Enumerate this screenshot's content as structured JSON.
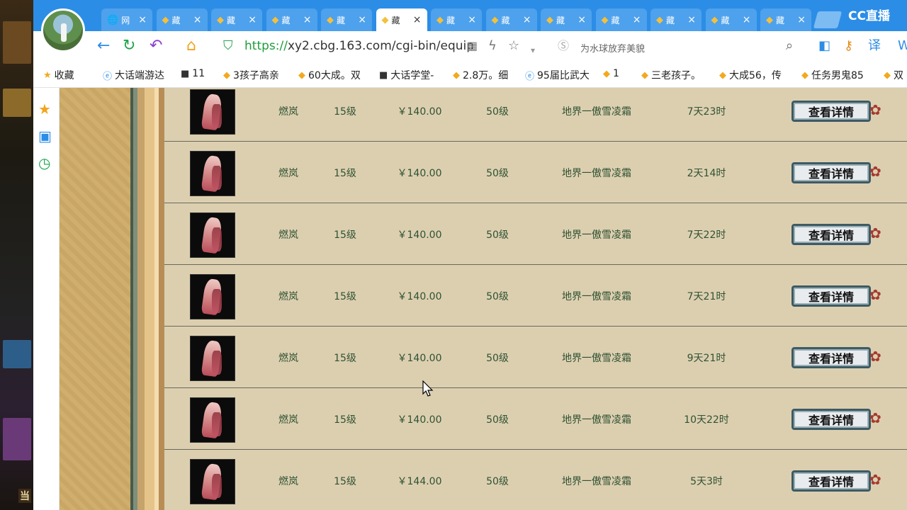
{
  "game_overlay": {
    "text": "当"
  },
  "browser": {
    "tabs": [
      {
        "title": "网",
        "icon": "globe-icon",
        "active": false
      },
      {
        "title": "藏",
        "icon": "cbg-icon",
        "active": false
      },
      {
        "title": "藏",
        "icon": "cbg-icon",
        "active": false
      },
      {
        "title": "藏",
        "icon": "cbg-icon",
        "active": false
      },
      {
        "title": "藏",
        "icon": "cbg-icon",
        "active": false
      },
      {
        "title": "藏",
        "icon": "cbg-icon",
        "active": true
      },
      {
        "title": "藏",
        "icon": "cbg-icon",
        "active": false
      },
      {
        "title": "藏",
        "icon": "cbg-icon",
        "active": false
      },
      {
        "title": "藏",
        "icon": "cbg-icon",
        "active": false
      },
      {
        "title": "藏",
        "icon": "cbg-icon",
        "active": false
      },
      {
        "title": "藏",
        "icon": "cbg-icon",
        "active": false
      },
      {
        "title": "藏",
        "icon": "cbg-icon",
        "active": false
      },
      {
        "title": "藏",
        "icon": "cbg-icon",
        "active": false
      }
    ],
    "brand": "CC直播",
    "url_scheme": "https://",
    "url_rest": "xy2.cbg.163.com/cgi-bin/equip",
    "search_suggestion": "为水球放弃美貌"
  },
  "bookmarks": [
    {
      "label": "收藏",
      "icon": "star-icon"
    },
    {
      "label": "大话端游达",
      "icon": "e-icon"
    },
    {
      "label": "11",
      "icon": "game-icon"
    },
    {
      "label": "3孩子高亲",
      "icon": "cbg-icon"
    },
    {
      "label": "60大成。双",
      "icon": "cbg-icon"
    },
    {
      "label": "大话学堂-",
      "icon": "game-icon"
    },
    {
      "label": "2.8万。细",
      "icon": "cbg-icon"
    },
    {
      "label": "95届比武大",
      "icon": "e-icon"
    },
    {
      "label": "1",
      "icon": "cbg-icon"
    },
    {
      "label": "三老孩子。",
      "icon": "cbg-icon"
    },
    {
      "label": "大成56，传",
      "icon": "cbg-icon"
    },
    {
      "label": "任务男鬼85",
      "icon": "cbg-icon"
    },
    {
      "label": "双",
      "icon": "cbg-icon"
    }
  ],
  "listing": {
    "button_label": "查看详情",
    "rows": [
      {
        "name": "燃岚",
        "level": "15级",
        "price": "￥140.00",
        "req_level": "50级",
        "server": "地界一傲雪凌霜",
        "time_left": "7天23时"
      },
      {
        "name": "燃岚",
        "level": "15级",
        "price": "￥140.00",
        "req_level": "50级",
        "server": "地界一傲雪凌霜",
        "time_left": "2天14时"
      },
      {
        "name": "燃岚",
        "level": "15级",
        "price": "￥140.00",
        "req_level": "50级",
        "server": "地界一傲雪凌霜",
        "time_left": "7天22时"
      },
      {
        "name": "燃岚",
        "level": "15级",
        "price": "￥140.00",
        "req_level": "50级",
        "server": "地界一傲雪凌霜",
        "time_left": "7天21时"
      },
      {
        "name": "燃岚",
        "level": "15级",
        "price": "￥140.00",
        "req_level": "50级",
        "server": "地界一傲雪凌霜",
        "time_left": "9天21时"
      },
      {
        "name": "燃岚",
        "level": "15级",
        "price": "￥140.00",
        "req_level": "50级",
        "server": "地界一傲雪凌霜",
        "time_left": "10天22时"
      },
      {
        "name": "燃岚",
        "level": "15级",
        "price": "￥144.00",
        "req_level": "50级",
        "server": "地界一傲雪凌霜",
        "time_left": "5天3时"
      }
    ]
  },
  "colors": {
    "tabbar": "#2c8de6",
    "row_text": "#2f5233",
    "page_bg": "#dccfb0"
  }
}
